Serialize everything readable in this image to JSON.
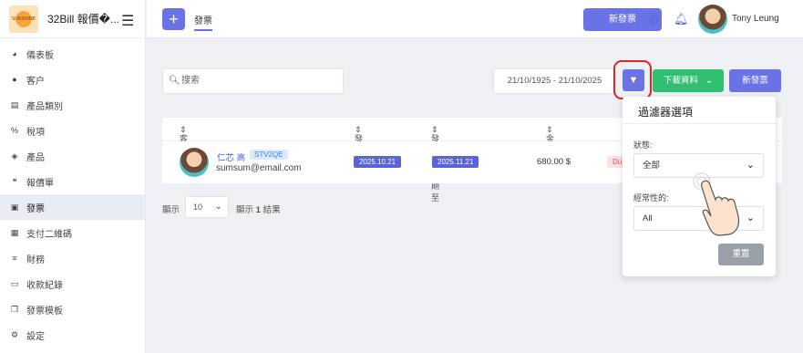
{
  "app": {
    "name": "32Bill 報價�...",
    "logo_text": "SUNSHINE"
  },
  "sidebar": {
    "items": [
      {
        "label": "儀表板",
        "icon": "dashboard-icon"
      },
      {
        "label": "客户",
        "icon": "user-icon"
      },
      {
        "label": "產品類別",
        "icon": "list-icon"
      },
      {
        "label": "稅項",
        "icon": "percent-icon"
      },
      {
        "label": "產品",
        "icon": "box-icon"
      },
      {
        "label": "報價單",
        "icon": "quote-icon"
      },
      {
        "label": "發票",
        "icon": "file-icon",
        "active": true
      },
      {
        "label": "支付二維碼",
        "icon": "qr-icon"
      },
      {
        "label": "財務",
        "icon": "ledger-icon"
      },
      {
        "label": "收款紀錄",
        "icon": "money-icon"
      },
      {
        "label": "發票模板",
        "icon": "template-icon"
      },
      {
        "label": "設定",
        "icon": "settings-icon"
      }
    ]
  },
  "topbar": {
    "tab": "發票",
    "new_invoice": "新發票",
    "user": "Tony Leung"
  },
  "toolbar": {
    "search_placeholder": "搜索",
    "date_range": "21/10/1925 - 21/10/2025",
    "download": "下載資料",
    "new_invoice": "新發票"
  },
  "table": {
    "headers": {
      "client": "客戶",
      "date": "發票日期",
      "due": "發票有效期至",
      "amount": "金額"
    },
    "rows": [
      {
        "client_name": "仁芯 高",
        "client_tag": "STV2QE",
        "email": "sumsum@email.com",
        "date": "2025.10.21",
        "due": "2025.11.21",
        "amount": "680.00 $",
        "status": "Du"
      }
    ]
  },
  "pagination": {
    "show_label": "顯示",
    "per_page": "10",
    "results_prefix": "顯示 ",
    "results_count": "1",
    "results_suffix": " 結果"
  },
  "filter_panel": {
    "title": "過濾器選項",
    "status_label": "狀態:",
    "status_value": "全部",
    "recurring_label": "經常性的:",
    "recurring_value": "All",
    "reset": "重置"
  },
  "colors": {
    "primary": "#6a73e5",
    "success": "#2fbf71",
    "highlight": "#e02424"
  }
}
